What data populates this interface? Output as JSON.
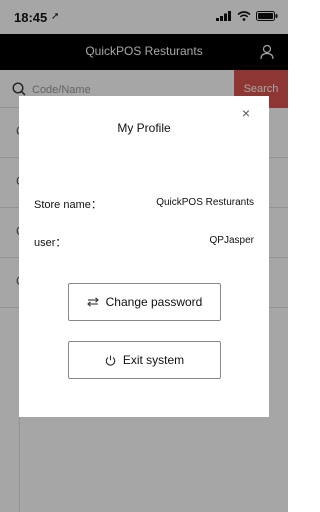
{
  "status_bar": {
    "time": "18:45",
    "arrow": "➚"
  },
  "header": {
    "title": "QuickPOS Resturants"
  },
  "search": {
    "placeholder": "Code/Name",
    "button_label": "Search"
  },
  "list": {
    "rows": [
      {
        "letter": "C"
      },
      {
        "letter": "C"
      },
      {
        "letter": "C"
      },
      {
        "letter": "C"
      }
    ]
  },
  "modal": {
    "title": "My Profile",
    "close_symbol": "×",
    "store_label": "Store name：",
    "store_value": "QuickPOS Resturants",
    "user_label": "user：",
    "user_value": "QPJasper",
    "change_password_label": "Change password",
    "exit_label": "Exit system"
  },
  "colors": {
    "header_bg": "#000000",
    "search_button_bg": "#d9534f",
    "overlay": "rgba(0,0,0,0.35)"
  },
  "icons": {
    "profile": "person-icon",
    "search": "search-icon",
    "close": "close-icon",
    "swap": "swap-arrows-icon",
    "power": "power-icon"
  }
}
